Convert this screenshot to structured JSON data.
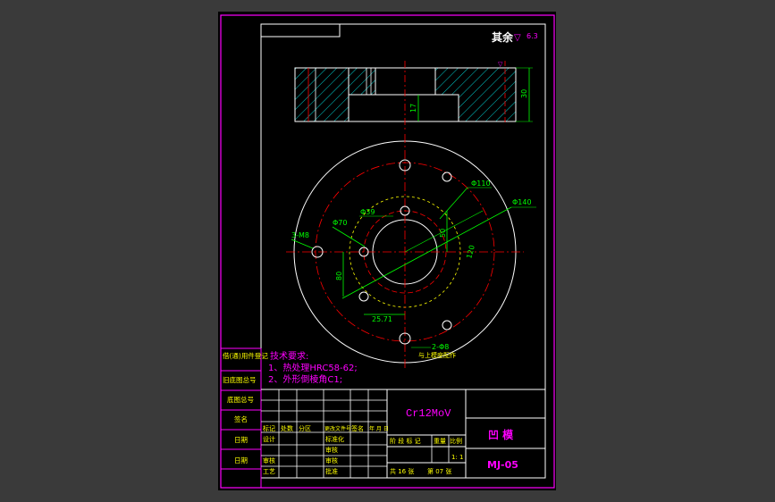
{
  "title_block": {
    "material": "Cr12MoV",
    "part_name": "凹 模",
    "drawing_no": "MJ-05",
    "scale": "1: 1",
    "sheets": "共 16 张",
    "sheet_no": "第 07 张",
    "header_row": [
      "标记",
      "处数",
      "分区",
      "更改文件号",
      "签名",
      "年 月 日"
    ],
    "stage_headers": [
      "阶 段 标 记",
      "重量",
      "比例"
    ],
    "col_labels": {
      "design": "设计",
      "standard": "标准化",
      "review": "审核",
      "process": "工艺",
      "approve": "批准",
      "proofread": "审核"
    }
  },
  "left_strip": {
    "used_for": "借(通)用件登记",
    "base_drawing_no": "旧底图总号",
    "base_drawing_no2": "底图总号",
    "signature": "签名",
    "date1": "日期",
    "date2": "日期"
  },
  "tech_req": {
    "title": "技术要求:",
    "items": [
      "1、热处理HRC58-62;",
      "2、外形倒棱角C1;"
    ]
  },
  "roughness": {
    "label": "其余",
    "value": "6.3"
  },
  "dimensions": {
    "height": "30",
    "depth": "17",
    "phi110": "Φ110",
    "phi140": "Φ140",
    "phi70": "Φ70",
    "phi39": "Φ39",
    "dim50": "50",
    "dim80": "80",
    "dim120": "120",
    "m8": "3-M8",
    "dim25": "25.71",
    "holes": "2-Φ8",
    "hole_note": "与上模座配作"
  },
  "colors": {
    "frame": "#ff00ff",
    "lines": "#ffffff",
    "dims": "#00ff00",
    "center": "#ff0000",
    "hatch": "#00ffff",
    "hidden": "#ffff00",
    "label": "#ffff00"
  }
}
